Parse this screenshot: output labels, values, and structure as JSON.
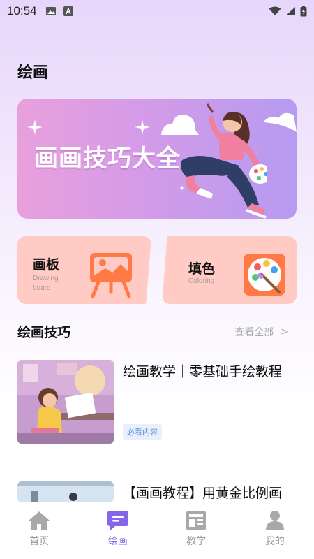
{
  "status_bar": {
    "time": "10:54"
  },
  "page": {
    "title": "绘画"
  },
  "banner": {
    "title": "画画技巧大全"
  },
  "features": [
    {
      "name": "画板",
      "subtitle": "Drawing board"
    },
    {
      "name": "填色",
      "subtitle": "Coloring"
    }
  ],
  "section": {
    "title": "绘画技巧",
    "view_all": "查看全部",
    "view_all_arrow": ">"
  },
  "articles": [
    {
      "title": "绘画教学｜零基础手绘教程",
      "tag": "必看内容"
    },
    {
      "title": "【画画教程】用黄金比例画"
    }
  ],
  "tabbar": {
    "items": [
      {
        "label": "首页",
        "icon": "home-icon"
      },
      {
        "label": "绘画",
        "icon": "paint-icon",
        "active": true
      },
      {
        "label": "教学",
        "icon": "news-icon"
      },
      {
        "label": "我的",
        "icon": "user-icon"
      }
    ]
  },
  "colors": {
    "accent": "#8566e6",
    "card": "#ffcbc4",
    "banner_start": "#e8a0dc",
    "banner_end": "#b59bf0"
  }
}
